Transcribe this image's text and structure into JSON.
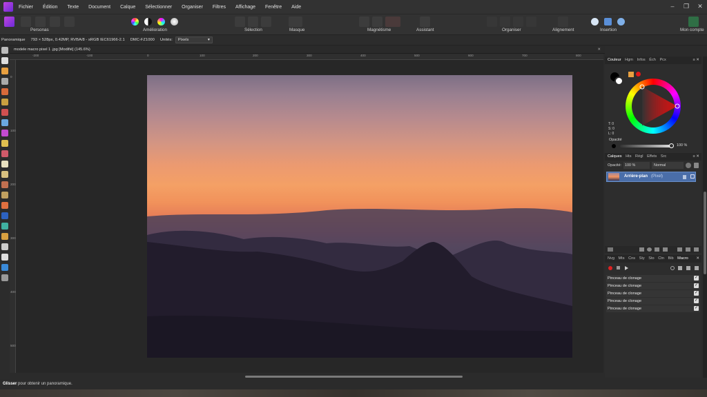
{
  "menu": [
    "Fichier",
    "Édition",
    "Texte",
    "Document",
    "Calque",
    "Sélectionner",
    "Organiser",
    "Filtres",
    "Affichage",
    "Fenêtre",
    "Aide"
  ],
  "window_controls": [
    "–",
    "❐",
    "✕"
  ],
  "toolbar": {
    "personas": "Personas",
    "amelioration": "Amélioration",
    "selection": "Sélection",
    "masque": "Masque",
    "magnetisme": "Magnétisme",
    "assistant": "Assistant",
    "organiser": "Organiser",
    "alignement": "Alignement",
    "insertion": "Insertion",
    "compte": "Mon compte"
  },
  "context": {
    "tool": "Panoramique",
    "info": "793 × 528px, 0.42MP, RVBA/8 - sRGB IEC61966-2.1",
    "camera": "DMC-FZ1000",
    "units_label": "Unités:",
    "units_value": "Pixels"
  },
  "document": {
    "tab_title": "modele macro pixel 1 .jpg [Modifié] (145.6%)",
    "close": "✕"
  },
  "rulers": {
    "h": [
      "-200",
      "-100",
      "0",
      "100",
      "200",
      "300",
      "400",
      "500",
      "600",
      "700",
      "800"
    ],
    "v": [
      "0",
      "100",
      "200",
      "300",
      "400",
      "500"
    ]
  },
  "status": {
    "bold": "Glisser",
    "rest": " pour obtenir un panoramique."
  },
  "color_panel": {
    "tabs": [
      "Couleur",
      "Hgm",
      "Infos",
      "Éch",
      "Pcx"
    ],
    "tlabels": [
      "T: 0",
      "S: 0",
      "L: 0"
    ],
    "opacity_label": "Opacité",
    "opacity_value": "100 %"
  },
  "layers_panel": {
    "tabs": [
      "Calques",
      "Hts",
      "Régl",
      "Effets",
      "Src"
    ],
    "opacity_label": "Opacité:",
    "opacity_value": "100 %",
    "blend": "Normal",
    "layer_name": "Arrière-plan",
    "layer_type": "(Pixel)"
  },
  "macro_panel": {
    "tabs": [
      "Nvg",
      "Mts",
      "Cns",
      "Sty",
      "Sto",
      "Ctn",
      "Bib",
      "Macro"
    ],
    "rows": [
      "Pinceau de clonage",
      "Pinceau de clonage",
      "Pinceau de clonage",
      "Pinceau de clonage",
      "Pinceau de clonage"
    ],
    "check": "✓"
  },
  "colors": {
    "accent": "#4a6ea9",
    "app": "#2b2b2b"
  }
}
